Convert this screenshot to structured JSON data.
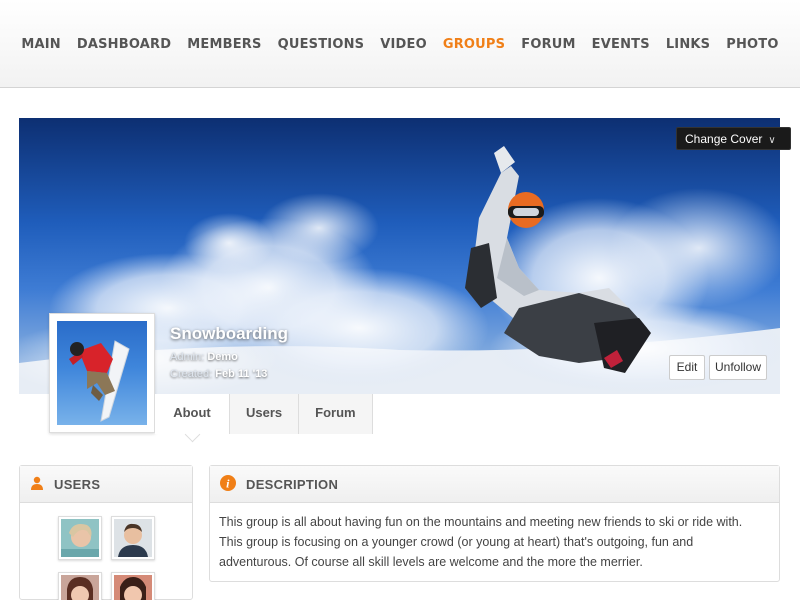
{
  "nav": {
    "items": [
      "MAIN",
      "DASHBOARD",
      "MEMBERS",
      "QUESTIONS",
      "VIDEO",
      "GROUPS",
      "FORUM",
      "EVENTS",
      "LINKS",
      "PHOTO"
    ],
    "active": "GROUPS",
    "active_color": "#f07f17"
  },
  "cover": {
    "change_cover_label": "Change Cover",
    "change_cover_icon": "chevron-down-icon"
  },
  "group": {
    "name": "Snowboarding",
    "admin_label": "Admin:",
    "admin_value": "Demo",
    "created_label": "Created:",
    "created_value": "Feb 11 '13",
    "edit_label": "Edit",
    "unfollow_label": "Unfollow"
  },
  "tabs": [
    "About",
    "Users",
    "Forum"
  ],
  "active_tab": "About",
  "users_panel": {
    "title": "USERS",
    "icon": "user-icon"
  },
  "description_panel": {
    "title": "DESCRIPTION",
    "icon": "info-icon",
    "lines": [
      "This group is all about having fun on the mountains and meeting new friends to ski or ride with.",
      "This group is focusing on a younger crowd (or young at heart) that's outgoing, fun and",
      "adventurous. Of course all skill levels are welcome and the more the merrier."
    ]
  },
  "colors": {
    "accent": "#f07f17"
  }
}
